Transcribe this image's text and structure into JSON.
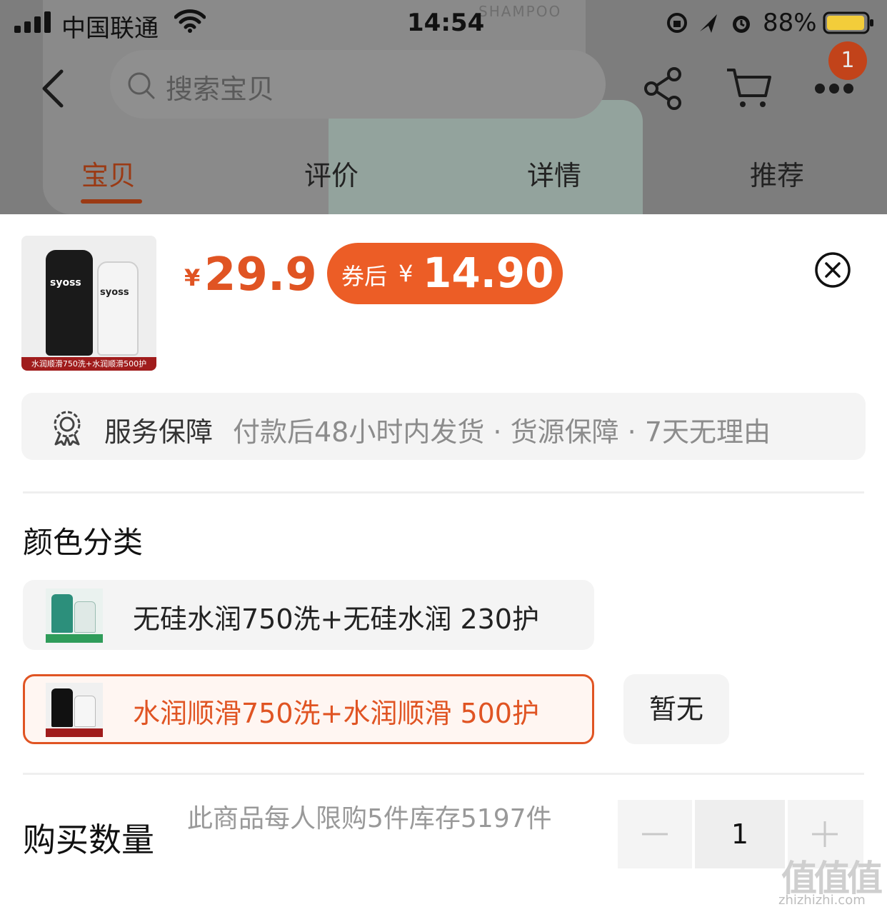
{
  "status_bar": {
    "carrier": "中国联通",
    "time": "14:54",
    "battery_percent": "88%"
  },
  "background_page": {
    "label_text": "SHAMPOO",
    "search_placeholder": "搜索宝贝",
    "cart_badge": "1",
    "tabs": [
      {
        "label": "宝贝",
        "active": true
      },
      {
        "label": "评价",
        "active": false
      },
      {
        "label": "详情",
        "active": false
      },
      {
        "label": "推荐",
        "active": false
      }
    ]
  },
  "sheet": {
    "thumbnail": {
      "brand_left": "syoss",
      "brand_right": "syoss",
      "caption": "水润顺滑750洗+水润顺滑500护"
    },
    "price": {
      "currency": "¥",
      "value": "29.9"
    },
    "coupon": {
      "label": "券后",
      "currency": "¥",
      "value": "14.90"
    },
    "service": {
      "title": "服务保障",
      "text": "付款后48小时内发货 · 货源保障 · 7天无理由"
    },
    "color_section": {
      "title": "颜色分类",
      "options": [
        {
          "label": "无硅水润750洗+无硅水润 230护",
          "selected": false
        },
        {
          "label": "水润顺滑750洗+水润顺滑 500护",
          "selected": true
        }
      ],
      "side_option": "暂无"
    },
    "quantity": {
      "title": "购买数量",
      "note": "此商品每人限购5件库存5197件",
      "value": "1"
    }
  },
  "watermark": {
    "logo": "值值值",
    "url": "zhizhizhi.com"
  },
  "colors": {
    "accent": "#e05423",
    "coupon_bg": "#ec5d26",
    "overlay": "#7d7d7d"
  }
}
